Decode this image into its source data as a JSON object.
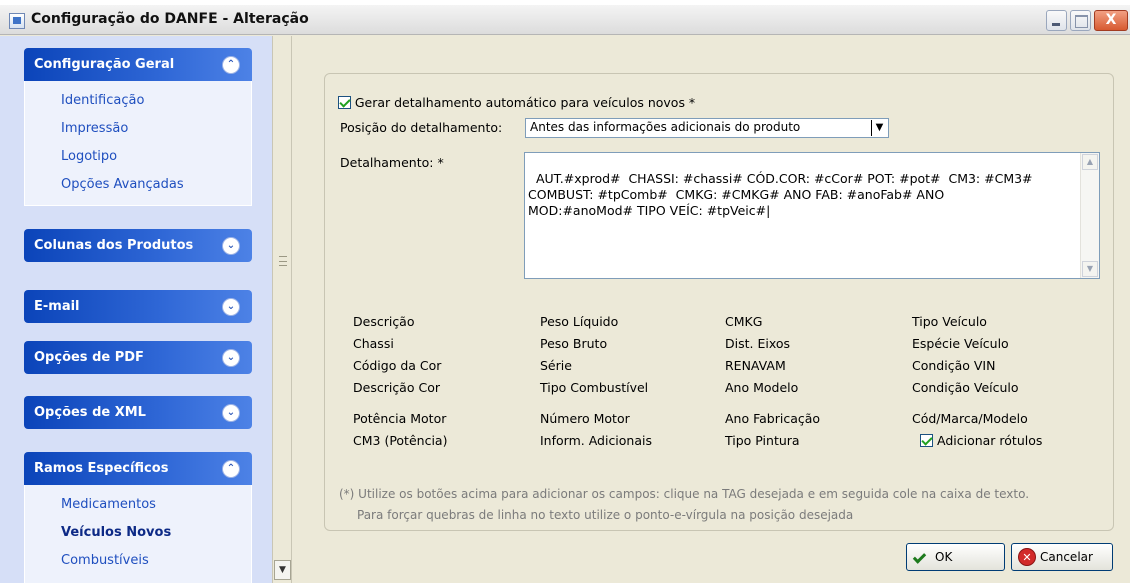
{
  "window": {
    "title": "Configuração do DANFE - Alteração",
    "close_glyph": "X"
  },
  "sidebar": {
    "groups": [
      {
        "title": "Configuração Geral",
        "expanded": true,
        "items": [
          "Identificação",
          "Impressão",
          "Logotipo",
          "Opções Avançadas"
        ]
      },
      {
        "title": "Colunas dos Produtos",
        "expanded": false,
        "items": []
      },
      {
        "title": "E-mail",
        "expanded": false,
        "items": []
      },
      {
        "title": "Opções de PDF",
        "expanded": false,
        "items": []
      },
      {
        "title": "Opções de XML",
        "expanded": false,
        "items": []
      },
      {
        "title": "Ramos Específicos",
        "expanded": true,
        "items": [
          "Medicamentos",
          "Veículos Novos",
          "Combustíveis"
        ],
        "active_item": "Veículos Novos"
      }
    ]
  },
  "form": {
    "auto_detail_label": "Gerar detalhamento automático para veículos novos *",
    "auto_detail_checked": true,
    "position_label": "Posição do detalhamento:",
    "position_value": "Antes das informações adicionais do produto",
    "detail_label": "Detalhamento: *",
    "detail_text": "AUT.#xprod#  CHASSI: #chassi# CÓD.COR: #cCor# POT: #pot#  CM3: #CM3#\nCOMBUST: #tpComb#  CMKG: #CMKG# ANO FAB: #anoFab# ANO\nMOD:#anoMod# TIPO VEÍC: #tpVeic#|"
  },
  "tags": {
    "col1": [
      "Descrição",
      "Chassi",
      "Código da Cor",
      "Descrição Cor",
      "Potência Motor",
      "CM3 (Potência)"
    ],
    "col2": [
      "Peso Líquido",
      "Peso Bruto",
      "Série",
      "Tipo Combustível",
      "Número Motor",
      "Inform. Adicionais"
    ],
    "col3": [
      "CMKG",
      "Dist. Eixos",
      "RENAVAM",
      "Ano Modelo",
      "Ano Fabricação",
      "Tipo Pintura"
    ],
    "col4": [
      "Tipo Veículo",
      "Espécie Veículo",
      "Condição VIN",
      "Condição Veículo",
      "Cód/Marca/Modelo"
    ]
  },
  "add_labels": {
    "label": "Adicionar rótulos",
    "checked": true
  },
  "notes": {
    "line1": "(*) Utilize os botões acima para adicionar os campos: clique na TAG desejada e em seguida cole na caixa de texto.",
    "line2": "Para forçar quebras de linha no texto utilize o ponto-e-vírgula na posição desejada"
  },
  "buttons": {
    "ok": "OK",
    "cancel": "Cancelar"
  },
  "icons": {
    "expand": "chevron-double-down-icon",
    "collapse": "chevron-double-up-icon",
    "ok": "checkmark-icon",
    "cancel": "cancel-x-icon"
  },
  "colors": {
    "sidebar_header": "#0b44b9",
    "sidebar_link": "#1f4fbf",
    "sidebar_bg": "#d6dff7",
    "window_bg": "#ece9d8"
  }
}
